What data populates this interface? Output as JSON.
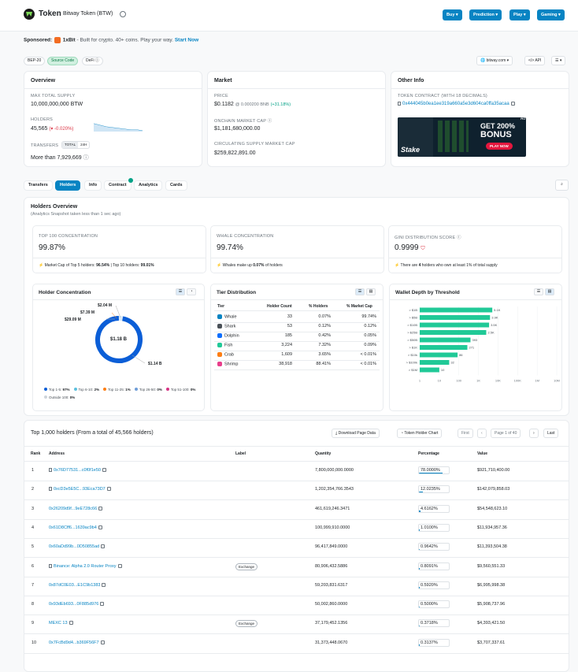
{
  "header": {
    "title": "Token",
    "token_name": "Bitway Token (BTW)",
    "buttons": [
      "Buy",
      "Prediction",
      "Play",
      "Gaming"
    ]
  },
  "sponsor": {
    "label": "Sponsored:",
    "brand": "1xBit",
    "text": "- Built for crypto. 40+ coins. Play your way.",
    "cta": "Start Now"
  },
  "tags": [
    "BEP-20",
    "Source Code",
    "DeFi"
  ],
  "toolbar": {
    "site": "bitway.com",
    "api": "API"
  },
  "overview": {
    "title": "Overview",
    "max_supply_label": "MAX TOTAL SUPPLY",
    "max_supply": "10,000,000,000 BTW",
    "holders_label": "HOLDERS",
    "holders": "45,565",
    "holders_change": "(▾ -0.020%)",
    "transfers_label": "TRANSFERS",
    "transfer_tabs": [
      "TOTAL",
      "24H"
    ],
    "transfers": "More than 7,929,669"
  },
  "market": {
    "title": "Market",
    "price_label": "PRICE",
    "price": "$0.1182",
    "price_bnb": "@ 0.000200 BNB",
    "price_change": "(+31.18%)",
    "mcap_label": "ONCHAIN MARKET CAP",
    "mcap": "$1,181,680,000.00",
    "circ_label": "CIRCULATING SUPPLY MARKET CAP",
    "circ": "$259,822,891.00"
  },
  "other": {
    "title": "Other Info",
    "contract_label": "TOKEN CONTRACT (WITH 18 DECIMALS)",
    "contract": "0x444045b0ea1ee319a660a5e3d604ca0ffa35acaa",
    "ad": {
      "tag": "Ad",
      "line1": "GET 200%",
      "line2": "BONUS",
      "brand": "Stake",
      "cta": "PLAY NOW"
    }
  },
  "tabs": [
    "Transfers",
    "Holders",
    "Info",
    "Contract",
    "Analytics",
    "Cards"
  ],
  "holders_overview": {
    "title": "Holders Overview",
    "subtitle": "(Analytics Snapshot taken less than 1 sec ago)",
    "top100_label": "TOP 100 CONCENTRATION",
    "top100": "99.87%",
    "top100_note_pre": "Market Cap of Top 5 holders: ",
    "top100_top5": "96.54%",
    "top100_note_mid": " | Top 10 holders: ",
    "top100_top10": "99.01%",
    "whale_label": "WHALE CONCENTRATION",
    "whale": "99.74%",
    "whale_note_pre": "Whales make up ",
    "whale_pct": "0.07%",
    "whale_note_post": " of holders",
    "gini_label": "GINI DISTRIBUTION SCORE",
    "gini": "0.9999",
    "gini_note_pre": "There are ",
    "gini_count": "4",
    "gini_note_post": " holders who own at least 1% of total supply"
  },
  "concentration": {
    "title": "Holder Concentration",
    "center": "$1.18 B",
    "labels": [
      "$2.04 M",
      "$7.39 M",
      "$29.09 M",
      "$1.14 B"
    ],
    "legend": [
      {
        "name": "Top 1-5:",
        "pct": "97%",
        "color": "#0b5ed7"
      },
      {
        "name": "Top 6-10:",
        "pct": "2%",
        "color": "#5bc0de"
      },
      {
        "name": "Top 11-25:",
        "pct": "1%",
        "color": "#fd7e14"
      },
      {
        "name": "Top 26-50:",
        "pct": "0%",
        "color": "#6f9ed8"
      },
      {
        "name": "Top 51-100:",
        "pct": "0%",
        "color": "#d63384"
      },
      {
        "name": "Outside 100:",
        "pct": "0%",
        "color": "#ced4da"
      }
    ]
  },
  "tier": {
    "title": "Tier Distribution",
    "headers": [
      "Tier",
      "Holder Count",
      "% Holders",
      "% Market Cap"
    ],
    "rows": [
      {
        "tier": "Whale",
        "count": "33",
        "holders": "0.07%",
        "mcap": "99.74%",
        "color": "#0784c3"
      },
      {
        "tier": "Shark",
        "count": "53",
        "holders": "0.12%",
        "mcap": "0.12%",
        "color": "#495057"
      },
      {
        "tier": "Dolphin",
        "count": "185",
        "holders": "0.42%",
        "mcap": "0.05%",
        "color": "#0d6efd"
      },
      {
        "tier": "Fish",
        "count": "3,224",
        "holders": "7.32%",
        "mcap": "0.09%",
        "color": "#20c997"
      },
      {
        "tier": "Crab",
        "count": "1,609",
        "holders": "3.65%",
        "mcap": "< 0.01%",
        "color": "#fd7e14"
      },
      {
        "tier": "Shrimp",
        "count": "38,918",
        "holders": "88.41%",
        "mcap": "< 0.01%",
        "color": "#e83e8c"
      }
    ]
  },
  "chart_data": {
    "type": "bar",
    "title": "Wallet Depth by Threshold",
    "orientation": "horizontal",
    "scale": "log",
    "categories": [
      "> $1B",
      "> $5B",
      "> $10B",
      "> $25B",
      "> $50B",
      "> $1K",
      "> $10k",
      "> $100k",
      "> $1M"
    ],
    "values": [
      5100,
      3900,
      3500,
      2500,
      393,
      271,
      86,
      32,
      10
    ],
    "value_labels": [
      "5.1K",
      "3.9K",
      "3.5K",
      "2.5K",
      "393",
      "271",
      "86",
      "32",
      "10"
    ],
    "ticks": [
      "1",
      "10",
      "100",
      "1K",
      "10K",
      "100K",
      "1M",
      "10M"
    ],
    "color": "#20c997"
  },
  "holders_table": {
    "title": "Top 1,000 holders (From a total of 45,566 holders)",
    "download": "Download Page Data",
    "chart_btn": "Token Holder Chart",
    "first": "First",
    "page": "Page 1 of 40",
    "last": "Last",
    "headers": [
      "Rank",
      "Address",
      "Label",
      "Quantity",
      "Percentage",
      "Value"
    ],
    "rows": [
      {
        "rank": "1",
        "address": "0x76D77531...c0f0f1e50",
        "contract": true,
        "label": "",
        "qty": "7,800,000,000.0000",
        "pct": "78.0000%",
        "pctv": 78,
        "value": "$921,710,400.00"
      },
      {
        "rank": "2",
        "address": "0xcD3e5E5C...93Eca73D7",
        "contract": true,
        "label": "",
        "qty": "1,202,354,766.3543",
        "pct": "12.0235%",
        "pctv": 12.0235,
        "value": "$142,079,858.03"
      },
      {
        "rank": "3",
        "address": "0x26209d9f...9eE728c66",
        "contract": false,
        "label": "",
        "qty": "461,619,246.3471",
        "pct": "4.6162%",
        "pctv": 4.6162,
        "value": "$54,548,623.10"
      },
      {
        "rank": "4",
        "address": "0x61D8Cff6...1639ac9b4",
        "contract": false,
        "label": "",
        "qty": "100,999,910.0000",
        "pct": "1.0100%",
        "pctv": 1.01,
        "value": "$11,934,957.36"
      },
      {
        "rank": "5",
        "address": "0x60aDd99b...0D50855ad",
        "contract": false,
        "label": "",
        "qty": "96,417,849.0000",
        "pct": "0.9642%",
        "pctv": 0.9642,
        "value": "$11,393,504.38"
      },
      {
        "rank": "6",
        "address": "Binance: Alpha 2.0 Router Proxy",
        "contract": true,
        "label": "Exchange",
        "qty": "80,906,432.5886",
        "pct": "0.8091%",
        "pctv": 0.8091,
        "value": "$9,560,551.33"
      },
      {
        "rank": "7",
        "address": "0x87dC0E03...E1C9b1383",
        "contract": false,
        "label": "",
        "qty": "59,203,831.6317",
        "pct": "0.5920%",
        "pctv": 0.592,
        "value": "$6,995,998.38"
      },
      {
        "rank": "8",
        "address": "0x93dEb693...0F885d976",
        "contract": false,
        "label": "",
        "qty": "50,002,860.0000",
        "pct": "0.5000%",
        "pctv": 0.5,
        "value": "$5,908,737.96"
      },
      {
        "rank": "9",
        "address": "MEXC 13",
        "contract": false,
        "label": "Exchange",
        "qty": "37,179,452.1356",
        "pct": "0.3718%",
        "pctv": 0.3718,
        "value": "$4,393,421.50"
      },
      {
        "rank": "10",
        "address": "0x7FcBd9d4...b369F56F7",
        "contract": false,
        "label": "",
        "qty": "31,373,448.0670",
        "pct": "0.3137%",
        "pctv": 0.3137,
        "value": "$3,707,337.61"
      }
    ]
  }
}
